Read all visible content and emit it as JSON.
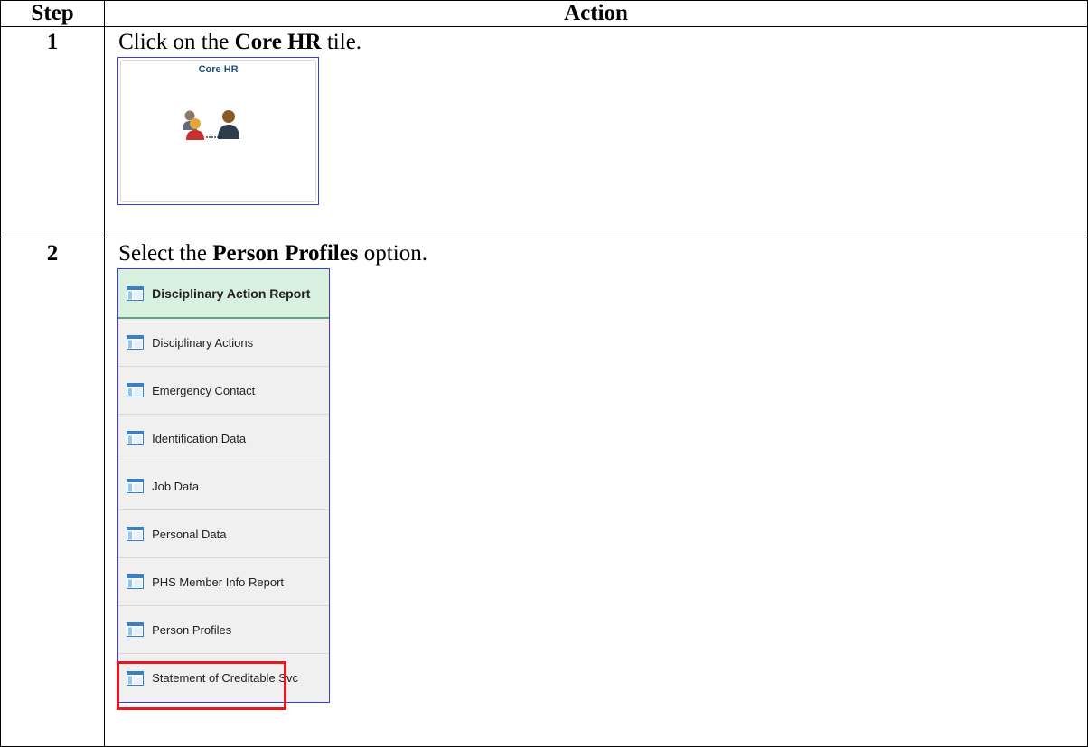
{
  "table": {
    "header_step": "Step",
    "header_action": "Action"
  },
  "steps": [
    {
      "number": "1",
      "text_before": "Click on the ",
      "text_bold": "Core HR",
      "text_after": " tile.",
      "tile": {
        "title": "Core HR",
        "icon": "people-connection-icon"
      }
    },
    {
      "number": "2",
      "text_before": "Select the ",
      "text_bold": "Person Profiles",
      "text_after": " option.",
      "menu": {
        "items": [
          "Disciplinary Action Report",
          "Disciplinary Actions",
          "Emergency Contact",
          "Identification Data",
          "Job Data",
          "Personal Data",
          "PHS Member Info Report",
          "Person Profiles",
          "Statement of Creditable Svc"
        ],
        "active_item": "Disciplinary Action Report",
        "highlighted_item": "Person Profiles",
        "item_icon": "page-icon",
        "highlight_color": "#e8171e"
      }
    }
  ]
}
